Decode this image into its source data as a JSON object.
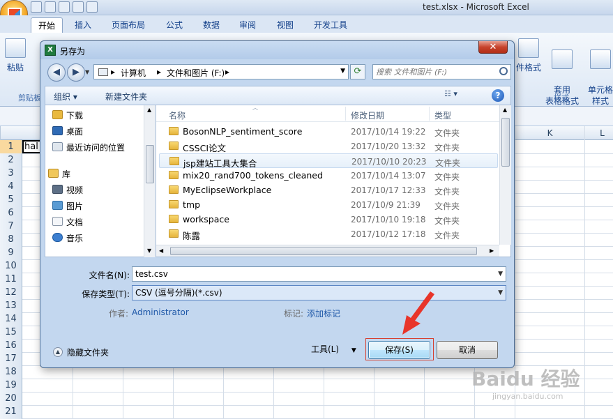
{
  "excel": {
    "window_title": "test.xlsx - Microsoft Excel",
    "ribbon_tabs": [
      "开始",
      "插入",
      "页面布局",
      "公式",
      "数据",
      "审阅",
      "视图",
      "开发工具"
    ],
    "paste_label": "粘贴",
    "clipboard_group": "剪贴板",
    "format_cells_label": "件格式",
    "table_format_label": "套用\n表格格式",
    "cell_styles_label": "单元格\n样式",
    "styles_group": "样式",
    "column_headers": [
      "K",
      "L"
    ],
    "row_numbers": [
      "1",
      "2",
      "3",
      "4",
      "5",
      "6",
      "7",
      "8",
      "9",
      "10",
      "11",
      "12",
      "13",
      "14",
      "15",
      "16",
      "17",
      "18",
      "19",
      "20",
      "21"
    ],
    "cell_a1": "hal"
  },
  "dialog": {
    "title": "另存为",
    "close": "✕",
    "address": [
      "计算机",
      "文件和图片 (F:)"
    ],
    "search_placeholder": "搜索 文件和图片 (F:)",
    "organize": "组织 ▾",
    "new_folder": "新建文件夹",
    "nav_items": [
      {
        "label": "下载",
        "icon": "download-folder-icon"
      },
      {
        "label": "桌面",
        "icon": "desktop-icon"
      },
      {
        "label": "最近访问的位置",
        "icon": "recent-places-icon"
      },
      {
        "label": "库",
        "icon": "libraries-icon"
      },
      {
        "label": "视频",
        "icon": "videos-icon"
      },
      {
        "label": "图片",
        "icon": "pictures-icon"
      },
      {
        "label": "文档",
        "icon": "documents-icon"
      },
      {
        "label": "音乐",
        "icon": "music-icon"
      }
    ],
    "columns": {
      "name": "名称",
      "date": "修改日期",
      "type": "类型"
    },
    "files": [
      {
        "name": "BosonNLP_sentiment_score",
        "date": "2017/10/14 19:22",
        "type": "文件夹"
      },
      {
        "name": "CSSCI论文",
        "date": "2017/10/20 13:32",
        "type": "文件夹"
      },
      {
        "name": "jsp建站工具大集合",
        "date": "2017/10/10 20:23",
        "type": "文件夹"
      },
      {
        "name": "mix20_rand700_tokens_cleaned",
        "date": "2017/10/14 13:07",
        "type": "文件夹"
      },
      {
        "name": "MyEclipseWorkplace",
        "date": "2017/10/17 12:33",
        "type": "文件夹"
      },
      {
        "name": "tmp",
        "date": "2017/10/9 21:39",
        "type": "文件夹"
      },
      {
        "name": "workspace",
        "date": "2017/10/10 19:18",
        "type": "文件夹"
      },
      {
        "name": "陈露",
        "date": "2017/10/12 17:18",
        "type": "文件夹"
      }
    ],
    "filename_label": "文件名(N):",
    "filename_value": "test.csv",
    "filetype_label": "保存类型(T):",
    "filetype_value": "CSV (逗号分隔)(*.csv)",
    "author_label": "作者:",
    "author_value": "Administrator",
    "tags_label": "标记:",
    "tags_value": "添加标记",
    "hide_folders": "隐藏文件夹",
    "tools": "工具(L)",
    "save": "保存(S)",
    "cancel": "取消"
  },
  "watermark": {
    "text": "Baidu 经验",
    "sub": "jingyan.baidu.com"
  },
  "colors": {
    "accent": "#15428b",
    "highlight": "#d64030",
    "arrow": "#e8352a"
  }
}
